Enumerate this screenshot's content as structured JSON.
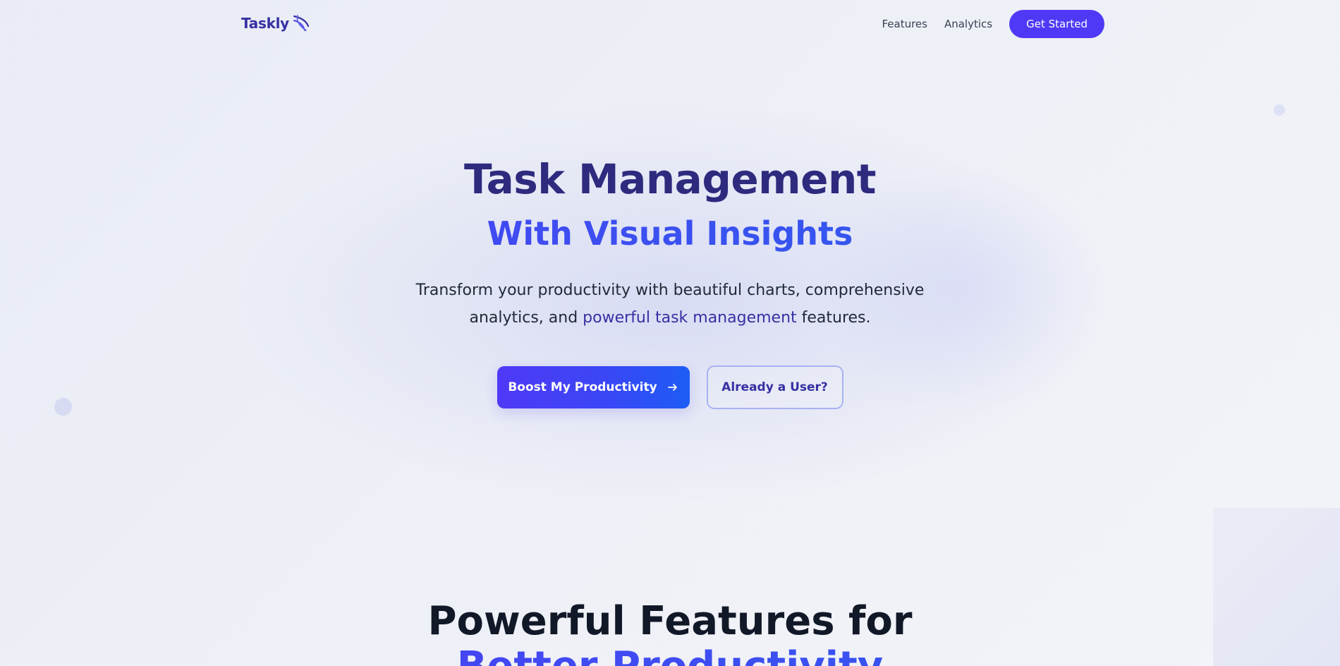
{
  "nav": {
    "logo_text": "Taskly",
    "logo_icon": "swoosh-icon",
    "links": [
      {
        "label": "Features"
      },
      {
        "label": "Analytics"
      }
    ],
    "cta_label": "Get Started"
  },
  "hero": {
    "title": "Task Management",
    "subtitle": "With Visual Insights",
    "description_part1": "Transform your productivity with beautiful charts, comprehensive analytics, and ",
    "description_highlight": "powerful task management",
    "description_part2": " features.",
    "primary_button_label": "Boost My Productivity",
    "primary_button_icon": "arrow-right-icon",
    "secondary_button_label": "Already a User?"
  },
  "features": {
    "title": "Powerful Features for",
    "subtitle": "Better Productivity"
  },
  "colors": {
    "brand": "#4f39f6",
    "brand_dark": "#2e2a7e",
    "accent_blue": "#2563eb",
    "background": "#eceff6"
  }
}
